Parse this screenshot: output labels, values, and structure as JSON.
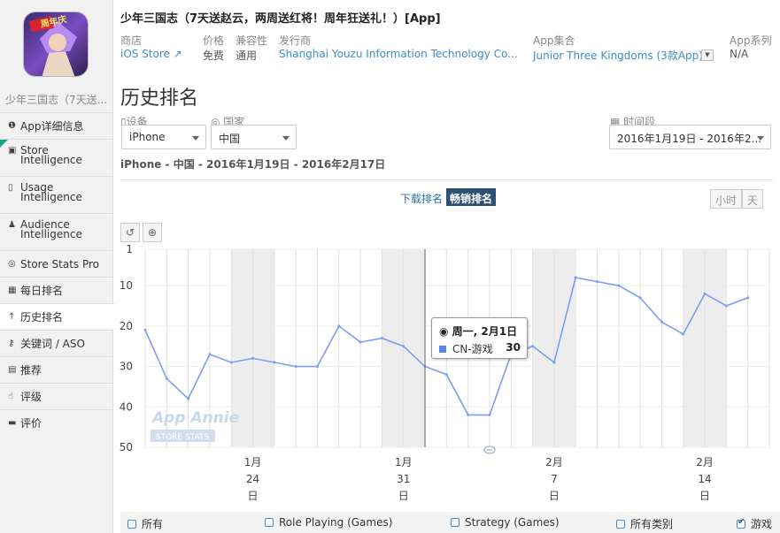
{
  "app": {
    "title": "少年三国志（7天送赵云，两周送红将！周年狂送礼！）[App]",
    "name_short": "少年三国志（7天送...",
    "icon_text": "周年庆",
    "meta": [
      {
        "label": "商店",
        "value": "iOS Store ↗"
      },
      {
        "label": "价格",
        "value": "免费"
      },
      {
        "label": "兼容性",
        "value": "通用"
      },
      {
        "label": "发行商",
        "value": "Shanghai Youzu Information Technology Co..."
      },
      {
        "label": "App集合",
        "value": "Junior Three Kingdoms (3款App)"
      },
      {
        "label": "App系列",
        "value": "N/A"
      }
    ]
  },
  "sidebar": {
    "items": [
      {
        "icon": "info-icon",
        "glyph": "❶",
        "label": "App详细信息"
      },
      {
        "icon": "store-icon",
        "glyph": "▣",
        "label": "Store Intelligence",
        "lines": [
          "Store",
          "Intelligence"
        ]
      },
      {
        "icon": "usage-icon",
        "glyph": "▯",
        "label": "Usage Intelligence",
        "lines": [
          "Usage",
          "Intelligence"
        ]
      },
      {
        "icon": "person-icon",
        "glyph": "♟",
        "label": "Audience Intelligence",
        "lines": [
          "Audience",
          "Intelligence"
        ]
      },
      {
        "icon": "globe-icon",
        "glyph": "◎",
        "label": "Store Stats Pro"
      },
      {
        "icon": "calendar-icon",
        "glyph": "▦",
        "label": "每日排名"
      },
      {
        "icon": "arrow-up-icon",
        "glyph": "↑",
        "label": "历史排名"
      },
      {
        "icon": "key-icon",
        "glyph": "⚷",
        "label": "关键词 / ASO"
      },
      {
        "icon": "bookmark-icon",
        "glyph": "▤",
        "label": "推荐"
      },
      {
        "icon": "thumb-icon",
        "glyph": "☝",
        "label": "评级"
      },
      {
        "icon": "comment-icon",
        "glyph": "▬",
        "label": "评价"
      }
    ],
    "active_index": 6
  },
  "page": {
    "title": "历史排名",
    "filters": {
      "device_label": "设备",
      "device_value": "iPhone",
      "country_label": "国家",
      "country_value": "中国",
      "period_label": "时间段",
      "period_value": "2016年1月19日 - 2016年2..."
    },
    "subtitle": "iPhone - 中国 - 2016年1月19日 - 2016年2月17日",
    "tabs": {
      "download": "下载排名",
      "grossing": "畅销排名"
    },
    "granularity": {
      "hour": "小时",
      "day": "天"
    }
  },
  "tooltip": {
    "date": "周一, 2月1日",
    "series": "CN-游戏",
    "value": "30"
  },
  "watermark": {
    "line1": "App Annie",
    "line2": "STORE STATS"
  },
  "legend": [
    {
      "label": "所有",
      "checked": false
    },
    {
      "label": "Role Playing (Games)",
      "checked": false
    },
    {
      "label": "Strategy (Games)",
      "checked": false
    },
    {
      "label": "所有类别",
      "checked": false
    },
    {
      "label": "游戏",
      "checked": true
    }
  ],
  "chart_data": {
    "type": "line",
    "title": "",
    "xlabel": "",
    "ylabel": "",
    "y_inverted": true,
    "ylim": [
      1,
      50
    ],
    "y_ticks": [
      1,
      10,
      20,
      30,
      40,
      50
    ],
    "x_ticks": [
      {
        "date": "2016-01-24",
        "lines": [
          "1月",
          "24",
          "日"
        ]
      },
      {
        "date": "2016-01-31",
        "lines": [
          "1月",
          "31",
          "日"
        ]
      },
      {
        "date": "2016-02-07",
        "lines": [
          "2月",
          "7",
          "日"
        ]
      },
      {
        "date": "2016-02-14",
        "lines": [
          "2月",
          "14",
          "日"
        ]
      }
    ],
    "weekend_shading": true,
    "grid": true,
    "color": "#7b9ef0",
    "series": [
      {
        "name": "CN-游戏",
        "x": [
          "2016-01-19",
          "2016-01-20",
          "2016-01-21",
          "2016-01-22",
          "2016-01-23",
          "2016-01-24",
          "2016-01-25",
          "2016-01-26",
          "2016-01-27",
          "2016-01-28",
          "2016-01-29",
          "2016-01-30",
          "2016-01-31",
          "2016-02-01",
          "2016-02-02",
          "2016-02-03",
          "2016-02-04",
          "2016-02-05",
          "2016-02-06",
          "2016-02-07",
          "2016-02-08",
          "2016-02-09",
          "2016-02-10",
          "2016-02-11",
          "2016-02-12",
          "2016-02-13",
          "2016-02-14",
          "2016-02-15",
          "2016-02-16",
          "2016-02-17"
        ],
        "values": [
          21,
          33,
          38,
          27,
          29,
          28,
          29,
          30,
          30,
          20,
          24,
          23,
          25,
          30,
          32,
          42,
          42,
          27,
          25,
          29,
          8,
          9,
          10,
          13,
          19,
          22,
          12,
          15,
          13,
          null
        ]
      }
    ]
  }
}
